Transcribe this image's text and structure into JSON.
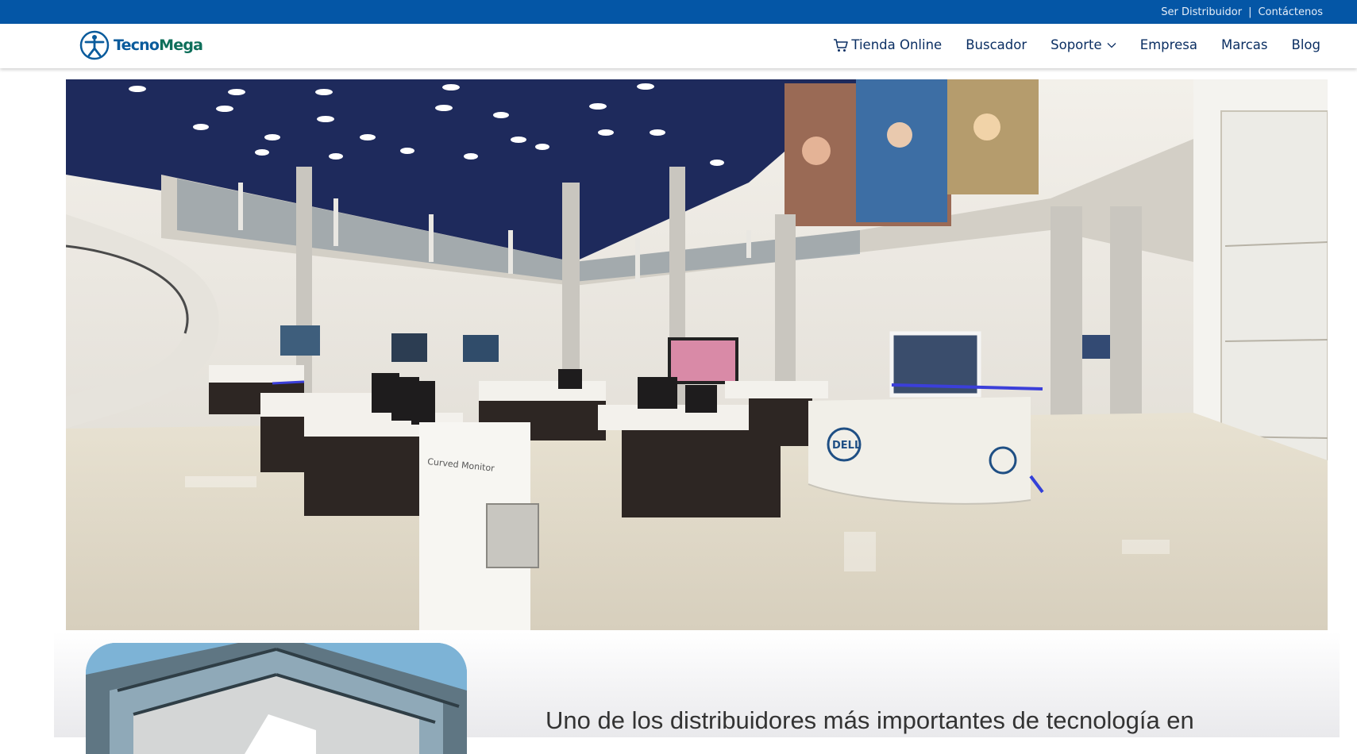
{
  "topbar": {
    "links": [
      "Ser Distribuidor",
      "Contáctenos"
    ],
    "separator": "|"
  },
  "header": {
    "logo_text_a": "Tecno",
    "logo_text_b": "Mega",
    "nav": {
      "store": "Tienda Online",
      "search": "Buscador",
      "support": "Soporte",
      "company": "Empresa",
      "brands": "Marcas",
      "blog": "Blog"
    }
  },
  "hero": {
    "booth_brand": "DELL",
    "stand_label": "Curved Monitor"
  },
  "about": {
    "heading": "Uno de los distribuidores más importantes de tecnología en"
  },
  "colors": {
    "topbar": "#0456a6",
    "nav_text": "#0b2f63",
    "logo_blue": "#0a5b9c"
  }
}
